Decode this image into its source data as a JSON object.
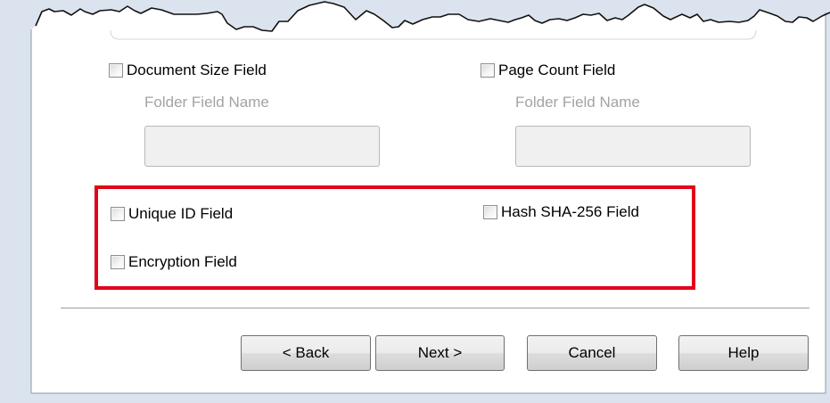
{
  "options": {
    "document_size": {
      "label": "Document Size Field",
      "checked": false
    },
    "page_count": {
      "label": "Page Count Field",
      "checked": false
    },
    "unique_id": {
      "label": "Unique ID Field",
      "checked": false
    },
    "hash_sha256": {
      "label": "Hash SHA-256 Field",
      "checked": false
    },
    "encryption": {
      "label": "Encryption Field",
      "checked": false
    }
  },
  "folder_fields": {
    "left": {
      "label": "Folder Field Name",
      "value": ""
    },
    "right": {
      "label": "Folder Field Name",
      "value": ""
    }
  },
  "buttons": {
    "back": "< Back",
    "next": "Next >",
    "cancel": "Cancel",
    "help": "Help"
  },
  "colors": {
    "highlight_border": "#e3001b",
    "dialog_background": "#ffffff",
    "window_frame": "#dbe4ee"
  }
}
